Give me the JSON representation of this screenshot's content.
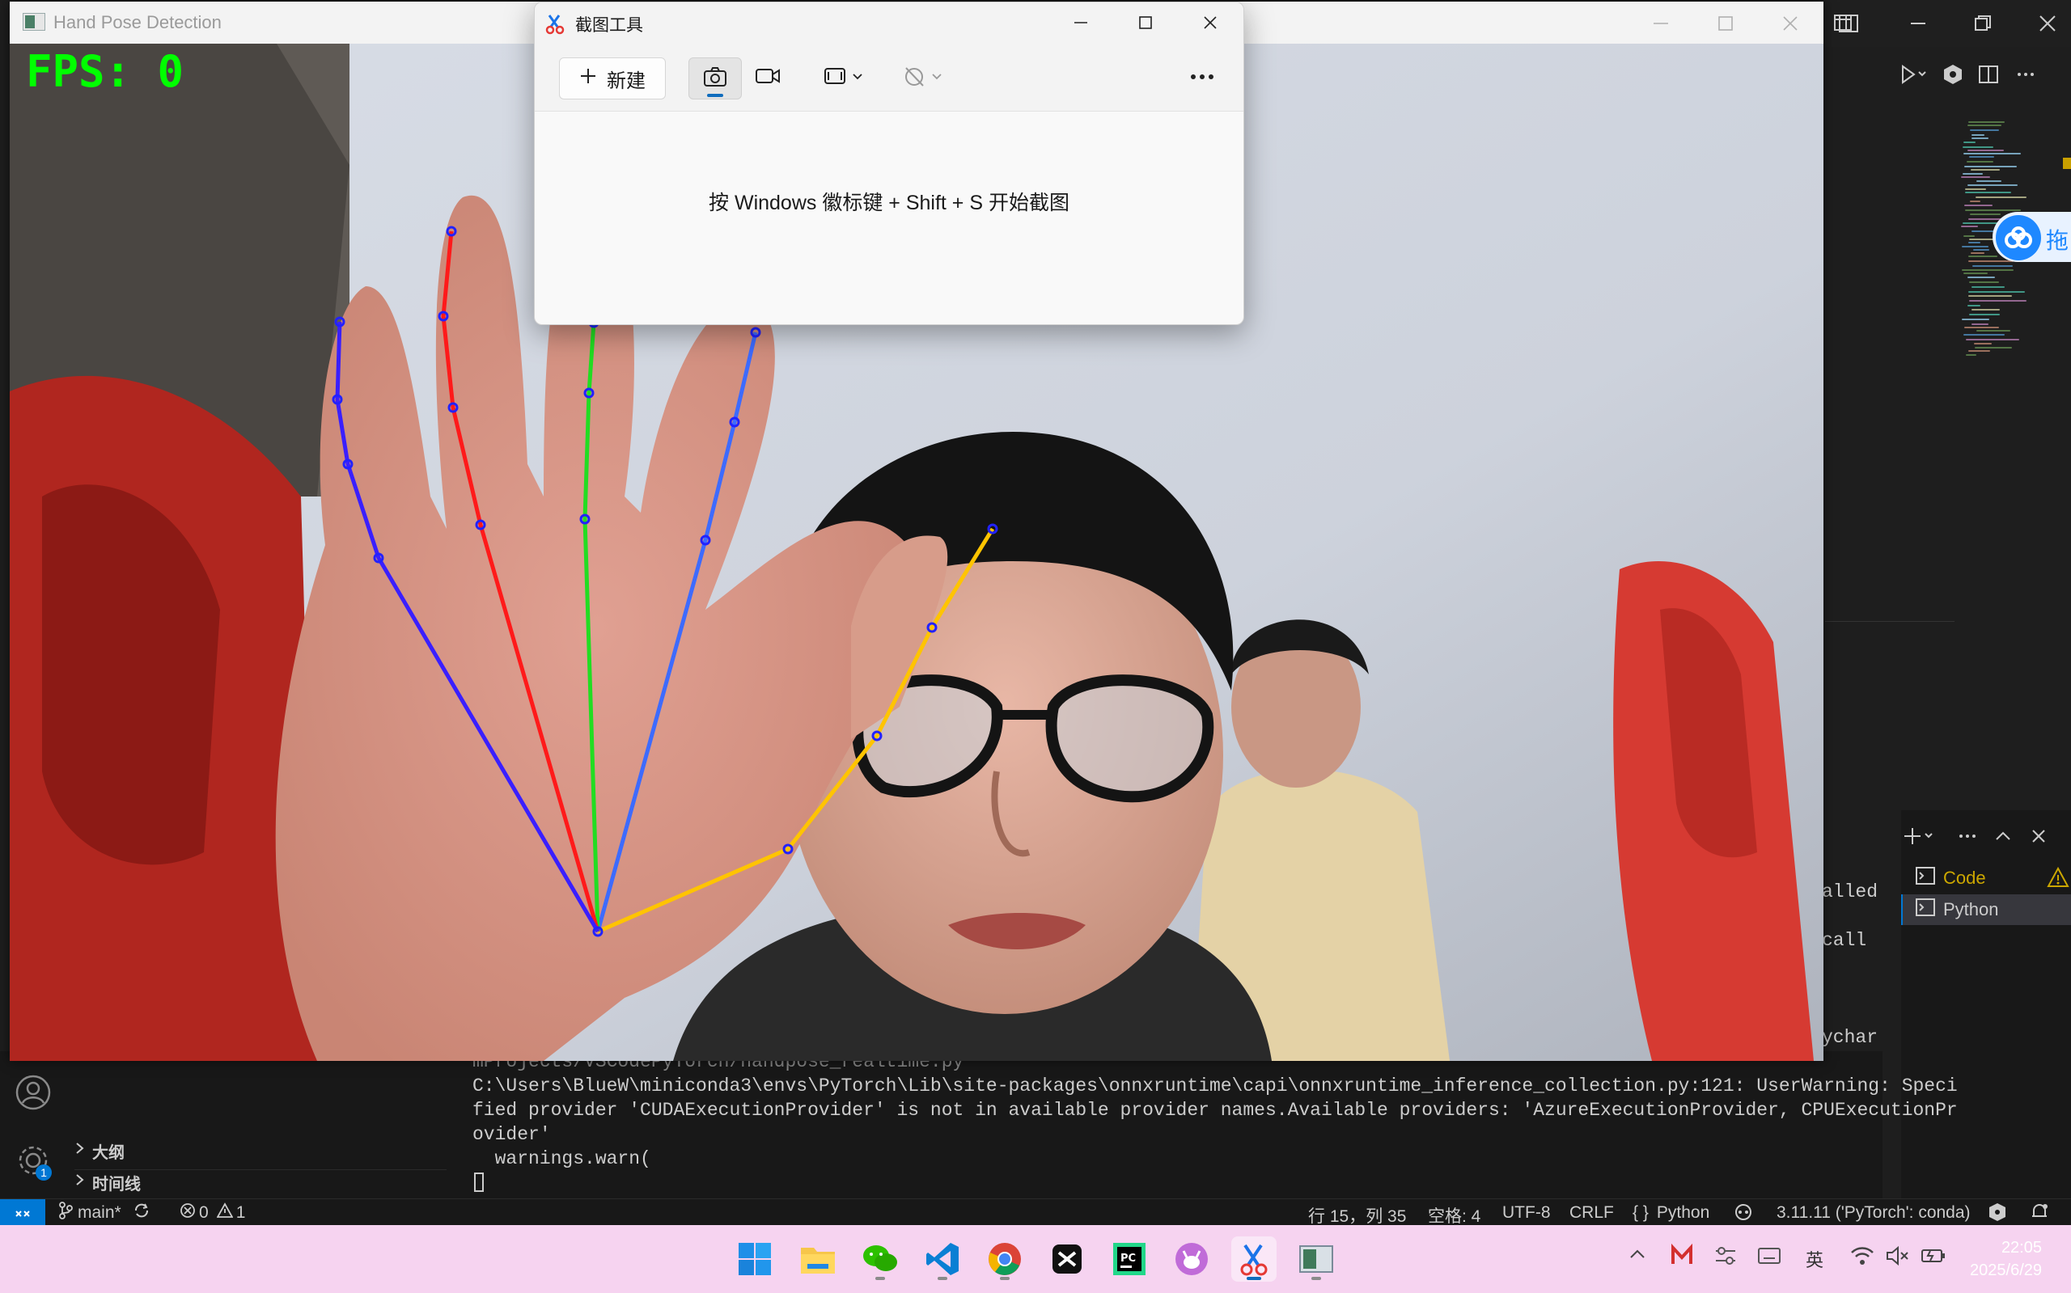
{
  "vscode": {
    "terminal_lines": [
      "mProjects/VSCodePyTorch/handpose_realtime.py",
      "C:\\Users\\BlueW\\miniconda3\\envs\\PyTorch\\Lib\\site-packages\\onnxruntime\\capi\\onnxruntime_inference_collection.py:121: UserWarning: Speci",
      "fied provider 'CUDAExecutionProvider' is not in available provider names.Available providers: 'AzureExecutionProvider, CPUExecutionPr",
      "ovider'",
      "  warnings.warn("
    ],
    "terminal_fragments": [
      "alled",
      "call",
      "ychar"
    ],
    "terminal_tabs": [
      {
        "label": "Code",
        "icon": "terminal-icon",
        "warning": true
      },
      {
        "label": "Python",
        "icon": "terminal-icon",
        "warning": false
      }
    ],
    "sidebar_sections": [
      {
        "label": "大纲"
      },
      {
        "label": "时间线"
      }
    ],
    "settings_badge": "1",
    "floating_label": "拖",
    "status": {
      "branch": "main*",
      "errors": "0",
      "warnings": "1",
      "position": "行 15，列 35",
      "spaces": "空格: 4",
      "encoding": "UTF-8",
      "eol": "CRLF",
      "language": "Python",
      "interpreter": "3.11.11 ('PyTorch': conda)"
    }
  },
  "hand_pose_window": {
    "title": "Hand Pose Detection",
    "fps_text": "FPS: 0",
    "skeleton_colors": {
      "thumb": "#ffc400",
      "index": "#3d6bff",
      "middle": "#22dd22",
      "ring": "#ff1a1a",
      "pinky": "#3a1fff",
      "joint": "#2222ff"
    }
  },
  "snipping_tool": {
    "title": "截图工具",
    "new_button": "新建",
    "hint": "按 Windows 徽标键 + Shift + S 开始截图"
  },
  "taskbar": {
    "apps": [
      {
        "name": "start-icon"
      },
      {
        "name": "file-explorer-icon"
      },
      {
        "name": "wechat-icon"
      },
      {
        "name": "vscode-icon"
      },
      {
        "name": "chrome-icon"
      },
      {
        "name": "capcut-icon"
      },
      {
        "name": "pycharm-icon"
      },
      {
        "name": "cat-app-icon"
      },
      {
        "name": "snipping-tool-icon"
      },
      {
        "name": "window-app-icon"
      }
    ],
    "ime": "英",
    "time": "22:05",
    "date": "2025/6/29"
  }
}
